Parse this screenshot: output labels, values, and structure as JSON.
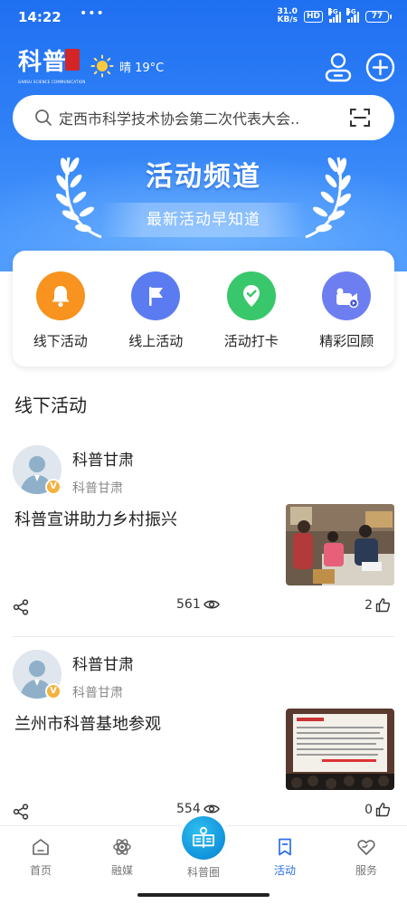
{
  "status_bar": {
    "time": "14:22",
    "dots": "•••",
    "net_speed_value": "31.0",
    "net_speed_unit": "KB/s",
    "hd": "HD",
    "sig1": "5G",
    "sig2": "5G",
    "battery": "77"
  },
  "header": {
    "logo_text": "科普",
    "logo_subtitle": "GANSU SCIENCE COMMUNICATION",
    "weather_icon": "sun-icon",
    "weather_text": "晴 19°C",
    "user_icon": "user-profile-icon",
    "add_icon": "plus-circle-icon"
  },
  "search": {
    "placeholder": "定西市科学技术协会第二次代表大会..",
    "scan_icon": "scan-icon"
  },
  "banner": {
    "title": "活动频道",
    "subtitle": "最新活动早知道"
  },
  "categories": [
    {
      "label": "线下活动",
      "icon": "bell-icon",
      "color": "#f7931e"
    },
    {
      "label": "线上活动",
      "icon": "flag-icon",
      "color": "#5b7cf0"
    },
    {
      "label": "活动打卡",
      "icon": "location-check-icon",
      "color": "#38c76a"
    },
    {
      "label": "精彩回顾",
      "icon": "video-camera-icon",
      "color": "#6d7ff0"
    }
  ],
  "section": {
    "title": "线下活动"
  },
  "posts": [
    {
      "author": "科普甘肃",
      "source": "科普甘肃",
      "verified": "V",
      "title": "科普宣讲助力乡村振兴",
      "views": "561",
      "likes": "2"
    },
    {
      "author": "科普甘肃",
      "source": "科普甘肃",
      "verified": "V",
      "title": "兰州市科普基地参观",
      "views": "554",
      "likes": "0"
    }
  ],
  "tabbar": {
    "tabs": [
      {
        "label": "首页",
        "icon": "home-icon"
      },
      {
        "label": "融媒",
        "icon": "atom-icon"
      },
      {
        "label": "科普圈",
        "icon": "book-reader-icon"
      },
      {
        "label": "活动",
        "icon": "bookmark-icon",
        "active": true
      },
      {
        "label": "服务",
        "icon": "heart-hand-icon"
      }
    ]
  },
  "colors": {
    "brand_blue": "#2a6fe8",
    "header_blue": "#1f6ff2",
    "verified_badge": "#f4b23e"
  }
}
